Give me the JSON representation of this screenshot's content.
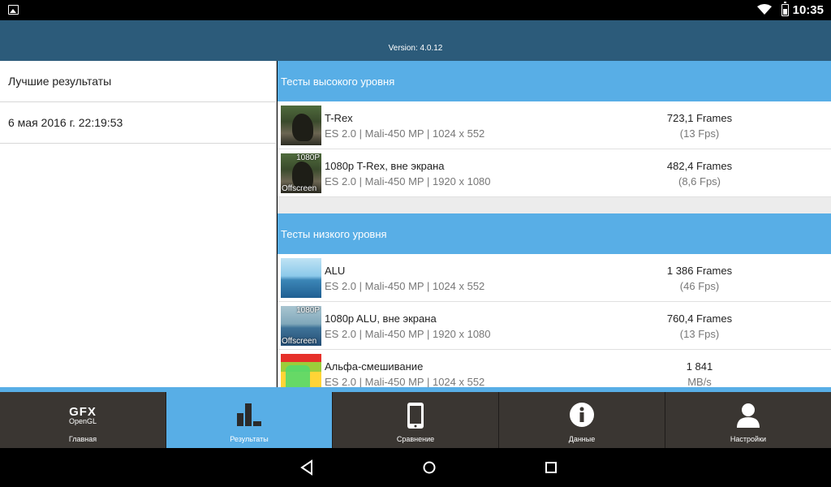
{
  "status": {
    "time": "10:35"
  },
  "header": {
    "version": "Version: 4.0.12"
  },
  "left": {
    "items": [
      {
        "label": "Лучшие результаты"
      },
      {
        "label": "6 мая 2016 г. 22:19:53"
      }
    ]
  },
  "high_level": {
    "title": "Тесты высокого уровня",
    "rows": [
      {
        "name": "T-Rex",
        "details": "ES 2.0 | Mali-450 MP | 1024 x 552",
        "value": "723,1 Frames",
        "sub_value": "(13 Fps)"
      },
      {
        "name": "1080p T-Rex, вне экрана",
        "details": "ES 2.0 | Mali-450 MP | 1920 x 1080",
        "value": "482,4 Frames",
        "sub_value": "(8,6 Fps)",
        "badge_top": "1080P",
        "badge_bottom": "Offscreen"
      }
    ]
  },
  "low_level": {
    "title": "Тесты низкого уровня",
    "rows": [
      {
        "name": "ALU",
        "details": "ES 2.0 | Mali-450 MP | 1024 x 552",
        "value": "1 386 Frames",
        "sub_value": "(46 Fps)"
      },
      {
        "name": "1080p ALU, вне экрана",
        "details": "ES 2.0 | Mali-450 MP | 1920 x 1080",
        "value": "760,4 Frames",
        "sub_value": "(13 Fps)",
        "badge_top": "1080P",
        "badge_bottom": "Offscreen"
      },
      {
        "name": "Альфа-смешивание",
        "details": "ES 2.0 | Mali-450 MP | 1024 x 552",
        "value": "1 841",
        "sub_value": "MB/s"
      }
    ]
  },
  "tabs": [
    {
      "label": "Главная",
      "icon": "gfx-logo-icon",
      "logo_main": "GFX",
      "logo_sub": "OpenGL"
    },
    {
      "label": "Результаты",
      "icon": "bar-chart-icon",
      "active": true
    },
    {
      "label": "Сравнение",
      "icon": "phone-icon"
    },
    {
      "label": "Данные",
      "icon": "info-icon"
    },
    {
      "label": "Настройки",
      "icon": "person-icon"
    }
  ],
  "colors": {
    "accent": "#58aee6",
    "header": "#2c5b7a",
    "tabbar": "#3a3632"
  }
}
